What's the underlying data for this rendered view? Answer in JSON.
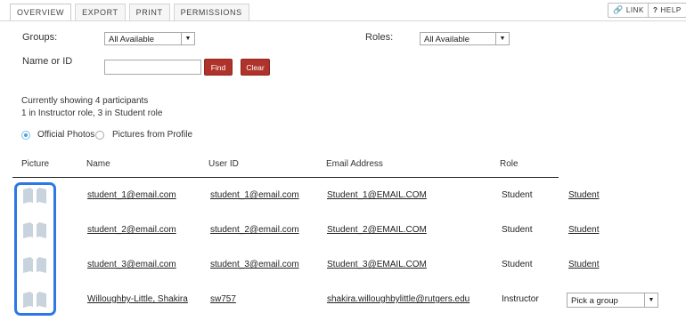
{
  "tabs": [
    "OVERVIEW",
    "EXPORT",
    "PRINT",
    "PERMISSIONS"
  ],
  "top_buttons": {
    "link": "LINK",
    "help": "HELP"
  },
  "filters": {
    "groups_label": "Groups:",
    "groups_value": "All Available",
    "roles_label": "Roles:",
    "roles_value": "All Available",
    "name_label": "Name or ID",
    "name_value": "",
    "find": "Find",
    "clear": "Clear"
  },
  "summary": {
    "line1": "Currently showing 4 participants",
    "line2": "1 in Instructor role, 3 in Student role"
  },
  "photo_options": {
    "official": "Official Photos",
    "profile": "Pictures from Profile",
    "selected": "official"
  },
  "table": {
    "headers": [
      "Picture",
      "Name",
      "User ID",
      "Email Address",
      "Role"
    ],
    "rows": [
      {
        "name": "student_1@email.com",
        "userid": "student_1@email.com",
        "email": "Student_1@EMAIL.COM",
        "role": "Student",
        "action": "Student"
      },
      {
        "name": "student_2@email.com",
        "userid": "student_2@email.com",
        "email": "Student_2@EMAIL.COM",
        "role": "Student",
        "action": "Student"
      },
      {
        "name": "student_3@email.com",
        "userid": "student_3@email.com",
        "email": "Student_3@EMAIL.COM",
        "role": "Student",
        "action": "Student"
      },
      {
        "name": "Willoughby-Little, Shakira",
        "userid": "sw757",
        "email": "shakira.willoughbylittle@rutgers.edu",
        "role": "Instructor",
        "action": "Pick a group"
      }
    ]
  },
  "colors": {
    "accent": "#2d78e6",
    "button_red": "#b0332b",
    "radio_selected": "#4aa4e0"
  }
}
